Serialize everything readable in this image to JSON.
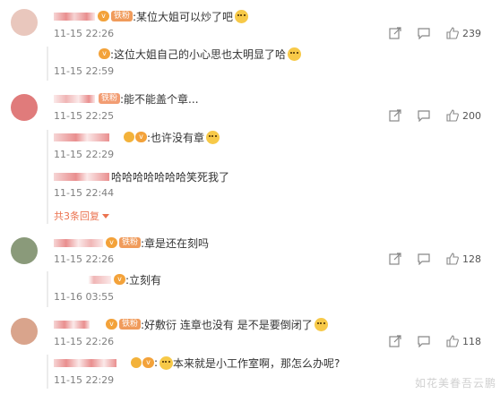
{
  "comments": [
    {
      "badge": "铁粉",
      "text": ":某位大姐可以炒了吧",
      "time": "11-15 22:26",
      "likes": "239",
      "avatar_color": "#e9c7bd",
      "replies": [
        {
          "text": ":这位大姐自己的小心思也太明显了哈",
          "time": "11-15 22:59"
        }
      ]
    },
    {
      "badge": "铁粉",
      "text": ":能不能盖个章...",
      "time": "11-15 22:25",
      "likes": "200",
      "avatar_color": "#e07b7b",
      "replies": [
        {
          "text": ":也许没有章",
          "time": "11-15 22:29"
        },
        {
          "text": "哈哈哈哈哈哈哈笑死我了",
          "time": "11-15 22:44"
        }
      ],
      "more": "共3条回复"
    },
    {
      "badge": "铁粉",
      "text": ":章是还在刻吗",
      "time": "11-15 22:26",
      "likes": "128",
      "avatar_color": "#8a9a7a",
      "replies": [
        {
          "text": ":立刻有",
          "time": "11-16 03:55"
        }
      ]
    },
    {
      "badge": "铁粉",
      "text": ":好敷衍 连章也没有 是不是要倒闭了",
      "time": "11-15 22:26",
      "likes": "118",
      "avatar_color": "#d9a48c",
      "replies": [
        {
          "text": "本来就是小工作室啊，那怎么办呢?",
          "time": "11-15 22:29"
        }
      ]
    }
  ],
  "icons": {
    "share": "share-icon",
    "comment": "comment-icon",
    "like": "like-icon",
    "vip": "vip-icon",
    "verified": "verified-badge-icon",
    "emoji": "emoji-icon",
    "expand": "triangle-down-icon"
  },
  "watermark": "如花美眷吾云鹏",
  "colors": {
    "link": "#eb7350",
    "time": "#808080",
    "badge": "#f09b5b"
  }
}
